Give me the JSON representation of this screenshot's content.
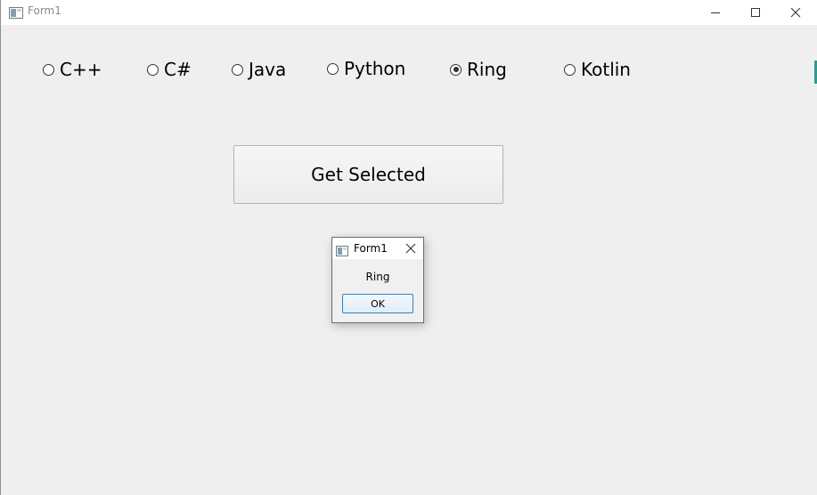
{
  "window": {
    "title": "Form1",
    "icon": "app-window-icon",
    "controls": [
      "minimize-icon",
      "maximize-icon",
      "close-icon"
    ]
  },
  "radios": [
    {
      "label": "C++",
      "checked": false
    },
    {
      "label": "C#",
      "checked": false
    },
    {
      "label": "Java",
      "checked": false
    },
    {
      "label": "Python",
      "checked": false
    },
    {
      "label": "Ring",
      "checked": true
    },
    {
      "label": "Kotlin",
      "checked": false
    }
  ],
  "main_button": {
    "label": "Get Selected"
  },
  "dialog": {
    "title": "Form1",
    "message": "Ring",
    "ok_label": "OK"
  },
  "colors": {
    "background": "#efefef",
    "titlebar": "#ffffff",
    "accent": "#3c7fb1"
  }
}
